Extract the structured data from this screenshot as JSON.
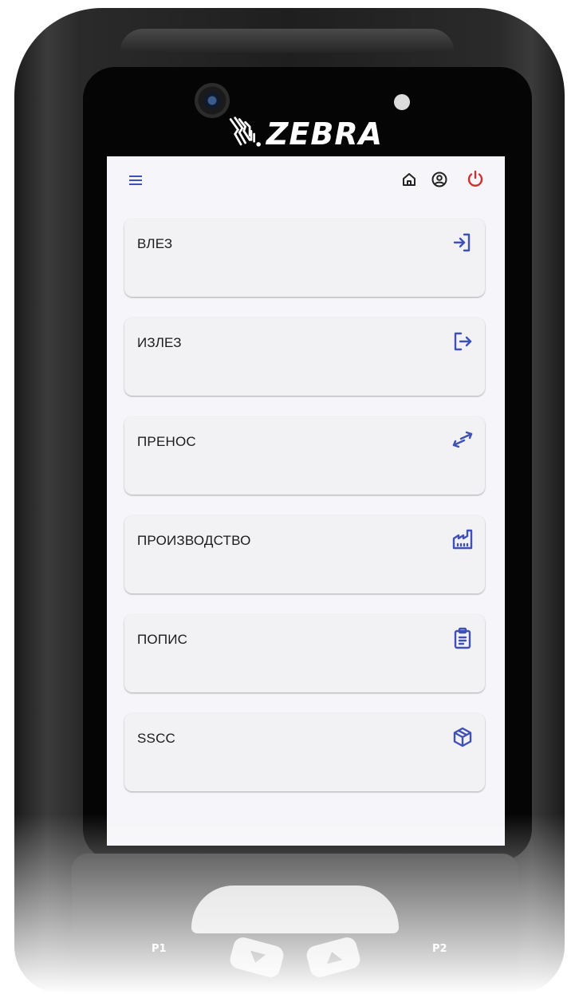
{
  "device": {
    "brand": "ZEBRA",
    "keys": {
      "p1": "P1",
      "p2": "P2"
    }
  },
  "colors": {
    "accent": "#3f51b5",
    "power": "#d32f2f",
    "card_bg": "#f2f2f4",
    "screen_bg": "#f6f6fa"
  },
  "topbar": {
    "menu_icon": "hamburger-menu-icon",
    "home_icon": "home-icon",
    "account_icon": "account-circle-icon",
    "power_icon": "power-icon"
  },
  "menu": {
    "items": [
      {
        "label": "ВЛЕЗ",
        "icon": "login-icon"
      },
      {
        "label": "ИЗЛЕЗ",
        "icon": "logout-icon"
      },
      {
        "label": "ПРЕНОС",
        "icon": "transfer-arrows-icon"
      },
      {
        "label": "ПРОИЗВОДСТВО",
        "icon": "factory-icon"
      },
      {
        "label": "ПОПИС",
        "icon": "clipboard-list-icon"
      },
      {
        "label": "SSCC",
        "icon": "package-box-icon"
      }
    ]
  }
}
